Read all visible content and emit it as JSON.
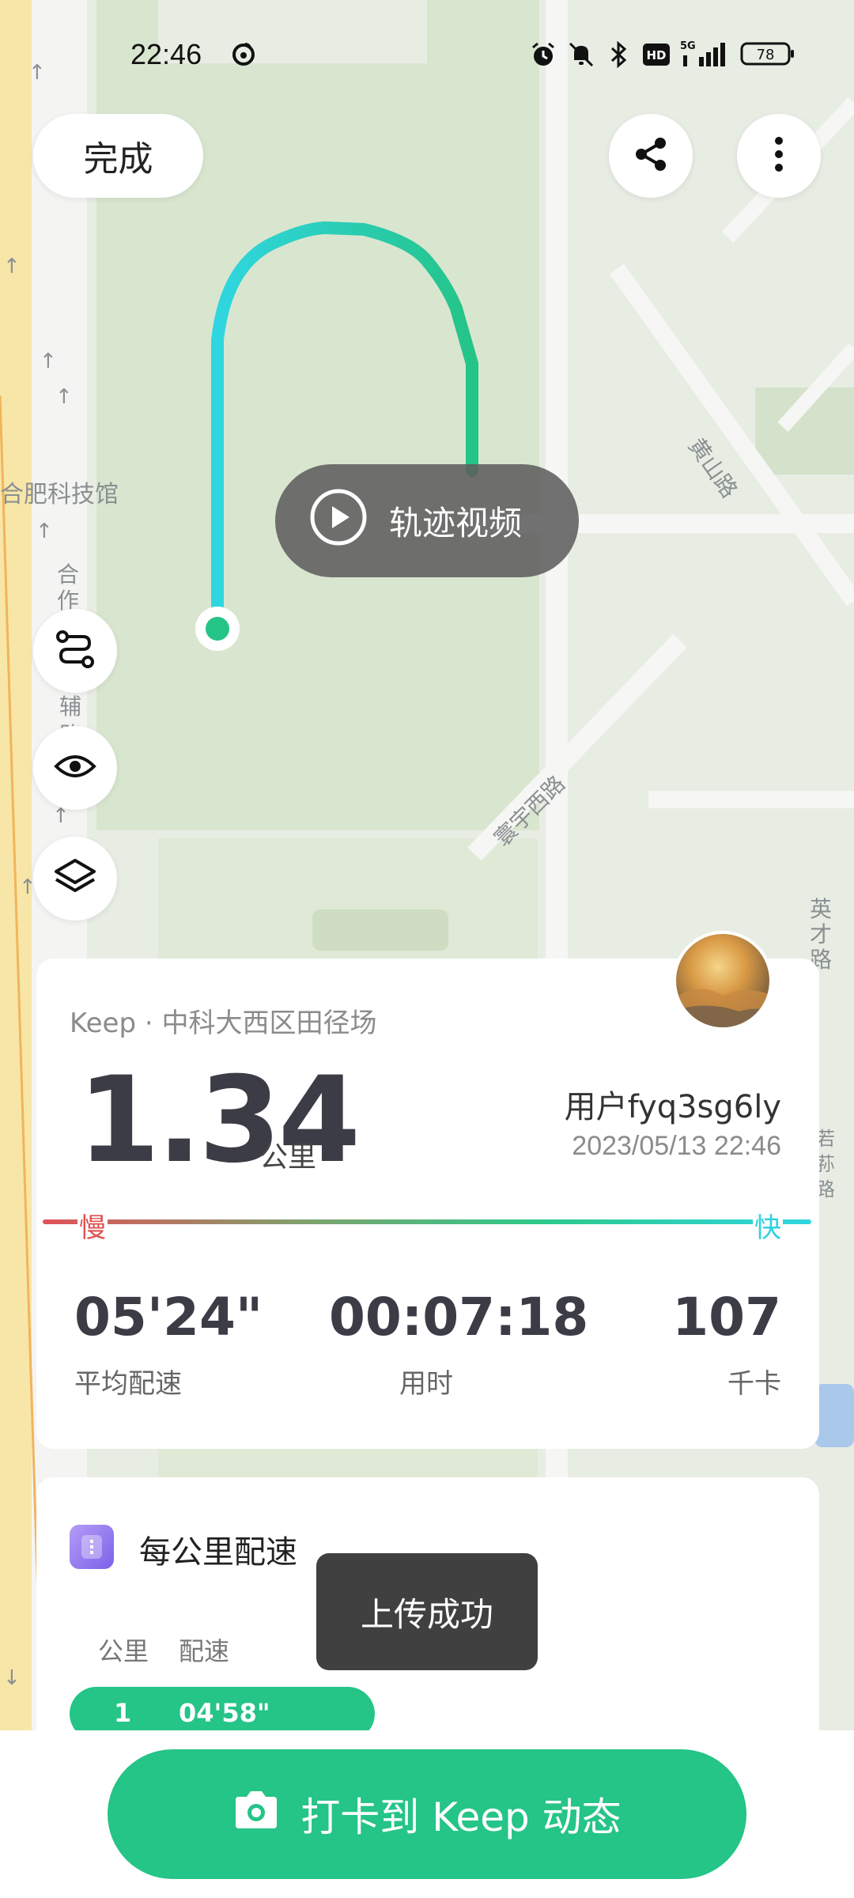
{
  "status_bar": {
    "time": "22:46",
    "network": "5G",
    "battery": "78",
    "hd_badge": "HD",
    "icons": [
      "netease-music-icon",
      "alarm-icon",
      "mute-icon",
      "bluetooth-icon",
      "hd-icon",
      "signal-icon",
      "battery-icon"
    ]
  },
  "toolbar": {
    "done_label": "完成",
    "share_icon": "share-icon",
    "more_icon": "more-vertical-icon"
  },
  "map": {
    "labels": {
      "museum": "合肥科技馆",
      "road_he": "合",
      "road_zuo": "作",
      "road_fu": "辅",
      "road_lu": "路",
      "road_yifu": "黄山路",
      "road_huanyu": "寰宇西路",
      "road_yingcai1": "英",
      "road_yingcai2": "才",
      "road_yingcai3": "路",
      "road_right2": "荪",
      "road_right3": "路",
      "road_right_small": "若"
    },
    "route_colors": {
      "start": "#2fd6e0",
      "end": "#25c487"
    },
    "video_label": "轨迹视频",
    "side_buttons": [
      "route-icon",
      "eye-icon",
      "layers-icon"
    ]
  },
  "summary": {
    "location": "Keep · 中科大西区田径场",
    "distance": "1.34",
    "distance_unit": "公里",
    "username": "用户fyq3sg6ly",
    "datetime": "2023/05/13 22:46",
    "slow_label": "慢",
    "fast_label": "快",
    "stats": [
      {
        "value": "05'24\"",
        "label": "平均配速"
      },
      {
        "value": "00:07:18",
        "label": "用时"
      },
      {
        "value": "107",
        "label": "千卡"
      }
    ]
  },
  "km_pace": {
    "title": "每公里配速",
    "col_km": "公里",
    "col_pace": "配速",
    "rows": [
      {
        "km": "1",
        "pace": "04'58\""
      }
    ]
  },
  "toast": "上传成功",
  "bottom": {
    "checkin_label": "打卡到 Keep 动态",
    "accent": "#25c487"
  }
}
